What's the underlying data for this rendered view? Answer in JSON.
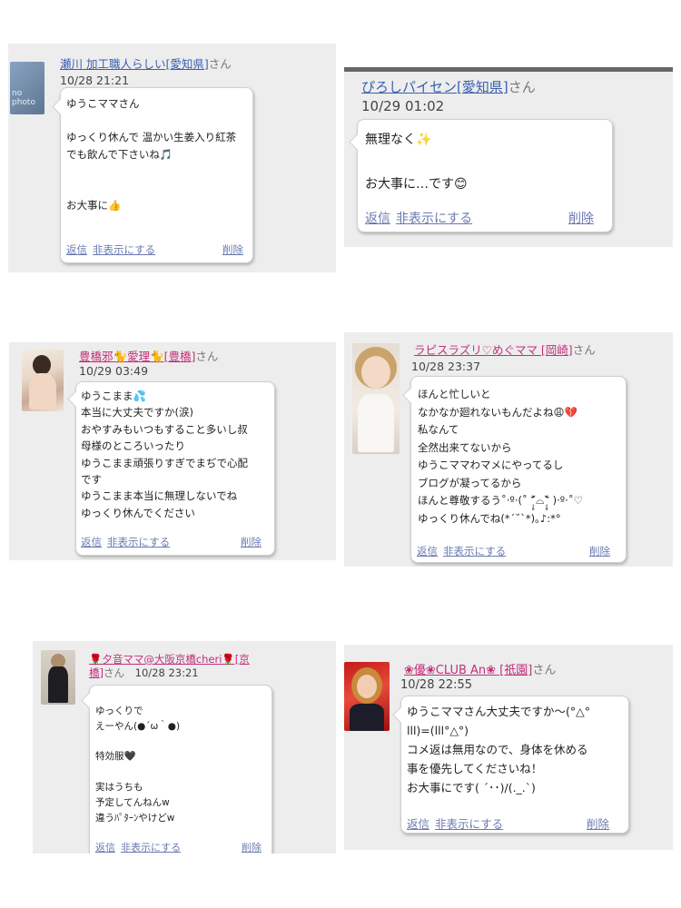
{
  "comments": [
    {
      "name": "瀬川 加工職人らしい[愛知県]",
      "suffix": "さん",
      "time": "10/28 21:21",
      "avatar_label": "no photo",
      "text": "ゆうこママさん\n\nゆっくり休んで 温かい生姜入り紅茶\nでも飲んで下さいね🎵\n\n\nお大事に👍",
      "reply": "返信",
      "hide": "非表示にする",
      "delete": "削除"
    },
    {
      "name": "ぴろしパイセン[愛知県]",
      "suffix": "さん",
      "time": "10/29 01:02",
      "text": "無理なく✨\n\nお大事に…です😊",
      "reply": "返信",
      "hide": "非表示にする",
      "delete": "削除"
    },
    {
      "name": "豊橋邪🐈愛理🐈[豊橋]",
      "suffix": "さん",
      "time": "10/29 03:49",
      "text": "ゆうこまま💦\n本当に大丈夫ですか(涙)\nおやすみもいつもすること多いし叔\n母様のところいったり\nゆうこまま頑張りすぎでまぢで心配\nです\nゆうこまま本当に無理しないでね\nゆっくり休んでください",
      "reply": "返信",
      "hide": "非表示にする",
      "delete": "削除"
    },
    {
      "name": "ラピスラズリ♡めぐママ [岡崎]",
      "suffix": "さん",
      "time": "10/28 23:37",
      "text": "ほんと忙しいと\nなかなか廻れないもんだよね😩💔\n私なんて\n全然出来てないから\nゆうこママわマメにやってるし\nブログが凝ってるから\nほんと尊敬するう˚‧º·(˚ ˃̣̣̥᷄⌓˂̣̣̥᷅ )‧º·˚♡\nゆっくり休んでね(*´˘`*)｡♪:*°",
      "reply": "返信",
      "hide": "非表示にする",
      "delete": "削除"
    },
    {
      "name_line1": "🌹夕音ママ@大阪京橋cheri🌹[京",
      "name_line2": "橋]",
      "suffix": "さん",
      "time": "10/28 23:21",
      "text": "ゆっくりで\nえーやん(●´ω｀●)\n\n特効服🖤\n\n実はうちも\n予定してんねんw\n違うﾊﾟﾀｰﾝやけどw",
      "reply": "返信",
      "hide": "非表示にする",
      "delete": "削除"
    },
    {
      "name": "❀優❀CLUB An❀ [祇園]",
      "suffix": "さん",
      "time": "10/28 22:55",
      "text": "ゆうこママさん大丈夫ですか〜(°△°\nlll)=(lll°△°)\nコメ返は無用なので、身体を休める\n事を優先してくださいね！\nお大事にです( ´･･)/(._.`)",
      "reply": "返信",
      "hide": "非表示にする",
      "delete": "削除"
    }
  ]
}
